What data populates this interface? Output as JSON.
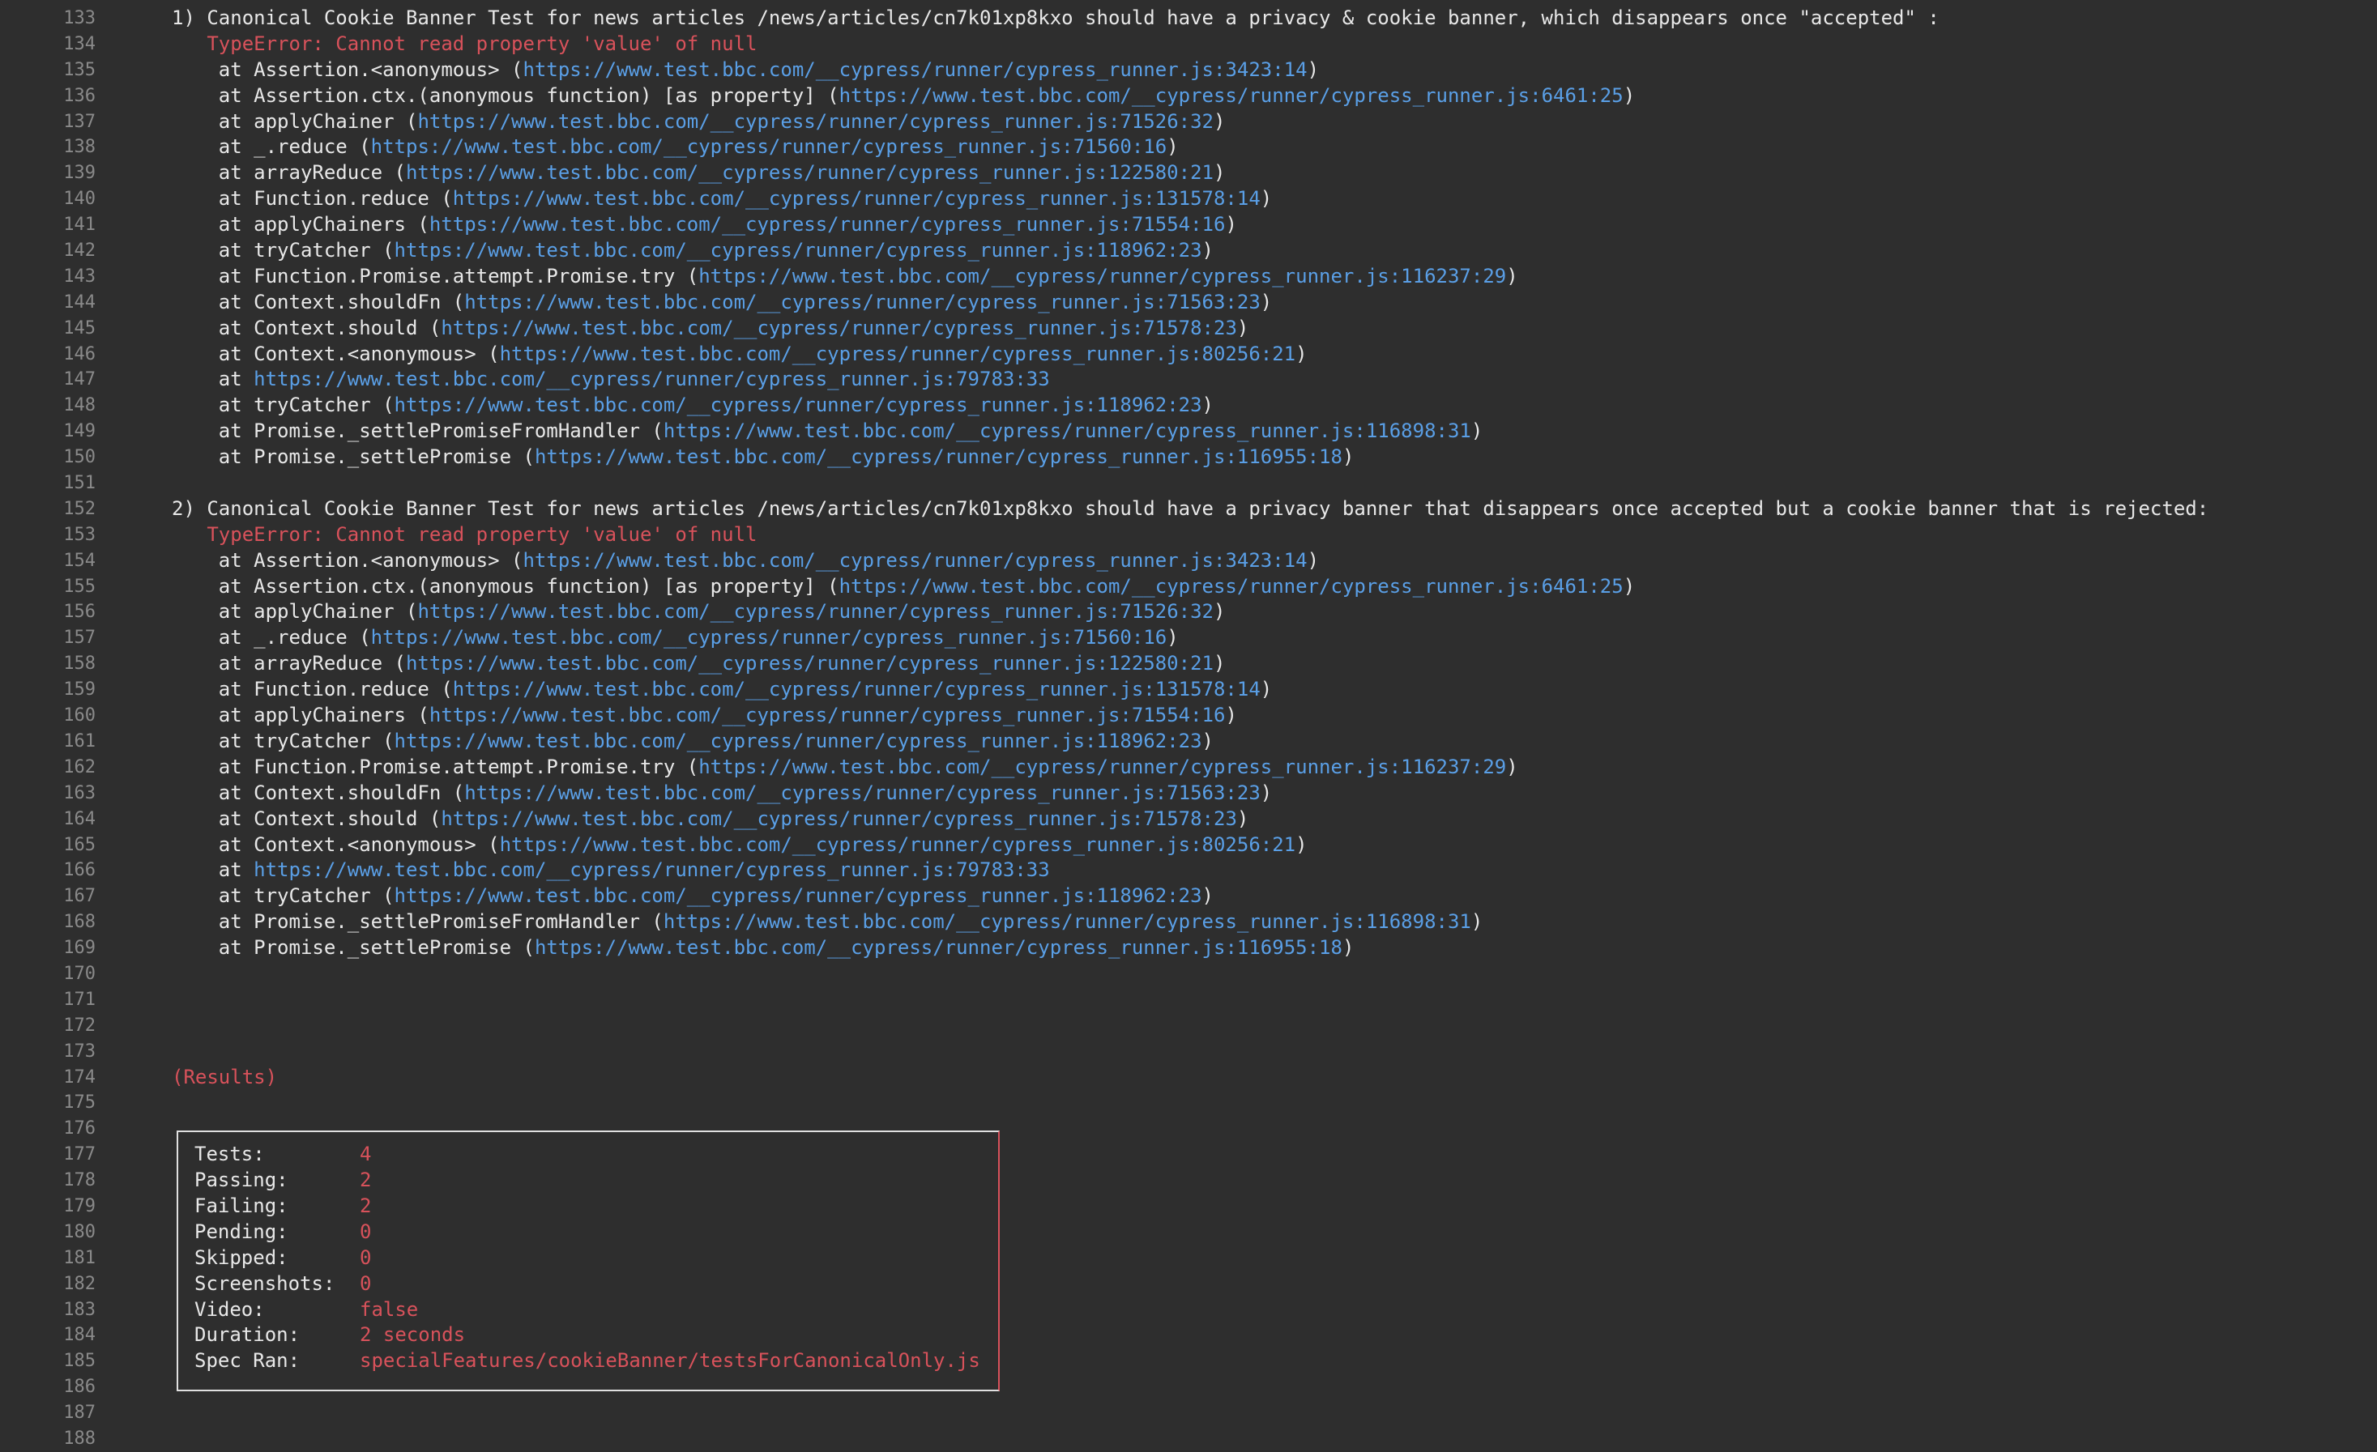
{
  "lines": [
    {
      "n": "133",
      "parts": [
        [
          "plain",
          "1) Canonical Cookie Banner Test for news articles /news/articles/cn7k01xp8kxo should have a privacy & cookie banner, which disappears once \"accepted\" :"
        ]
      ]
    },
    {
      "n": "134",
      "parts": [
        [
          "err",
          "   TypeError: Cannot read property 'value' of null"
        ]
      ]
    },
    {
      "n": "135",
      "parts": [
        [
          "plain",
          "    at Assertion.<anonymous> ("
        ],
        [
          "url",
          "https://www.test.bbc.com/__cypress/runner/cypress_runner.js:3423:14"
        ],
        [
          "plain",
          ")"
        ]
      ]
    },
    {
      "n": "136",
      "parts": [
        [
          "plain",
          "    at Assertion.ctx.(anonymous function) [as property] ("
        ],
        [
          "url",
          "https://www.test.bbc.com/__cypress/runner/cypress_runner.js:6461:25"
        ],
        [
          "plain",
          ")"
        ]
      ]
    },
    {
      "n": "137",
      "parts": [
        [
          "plain",
          "    at applyChainer ("
        ],
        [
          "url",
          "https://www.test.bbc.com/__cypress/runner/cypress_runner.js:71526:32"
        ],
        [
          "plain",
          ")"
        ]
      ]
    },
    {
      "n": "138",
      "parts": [
        [
          "plain",
          "    at _.reduce ("
        ],
        [
          "url",
          "https://www.test.bbc.com/__cypress/runner/cypress_runner.js:71560:16"
        ],
        [
          "plain",
          ")"
        ]
      ]
    },
    {
      "n": "139",
      "parts": [
        [
          "plain",
          "    at arrayReduce ("
        ],
        [
          "url",
          "https://www.test.bbc.com/__cypress/runner/cypress_runner.js:122580:21"
        ],
        [
          "plain",
          ")"
        ]
      ]
    },
    {
      "n": "140",
      "parts": [
        [
          "plain",
          "    at Function.reduce ("
        ],
        [
          "url",
          "https://www.test.bbc.com/__cypress/runner/cypress_runner.js:131578:14"
        ],
        [
          "plain",
          ")"
        ]
      ]
    },
    {
      "n": "141",
      "parts": [
        [
          "plain",
          "    at applyChainers ("
        ],
        [
          "url",
          "https://www.test.bbc.com/__cypress/runner/cypress_runner.js:71554:16"
        ],
        [
          "plain",
          ")"
        ]
      ]
    },
    {
      "n": "142",
      "parts": [
        [
          "plain",
          "    at tryCatcher ("
        ],
        [
          "url",
          "https://www.test.bbc.com/__cypress/runner/cypress_runner.js:118962:23"
        ],
        [
          "plain",
          ")"
        ]
      ]
    },
    {
      "n": "143",
      "parts": [
        [
          "plain",
          "    at Function.Promise.attempt.Promise.try ("
        ],
        [
          "url",
          "https://www.test.bbc.com/__cypress/runner/cypress_runner.js:116237:29"
        ],
        [
          "plain",
          ")"
        ]
      ]
    },
    {
      "n": "144",
      "parts": [
        [
          "plain",
          "    at Context.shouldFn ("
        ],
        [
          "url",
          "https://www.test.bbc.com/__cypress/runner/cypress_runner.js:71563:23"
        ],
        [
          "plain",
          ")"
        ]
      ]
    },
    {
      "n": "145",
      "parts": [
        [
          "plain",
          "    at Context.should ("
        ],
        [
          "url",
          "https://www.test.bbc.com/__cypress/runner/cypress_runner.js:71578:23"
        ],
        [
          "plain",
          ")"
        ]
      ]
    },
    {
      "n": "146",
      "parts": [
        [
          "plain",
          "    at Context.<anonymous> ("
        ],
        [
          "url",
          "https://www.test.bbc.com/__cypress/runner/cypress_runner.js:80256:21"
        ],
        [
          "plain",
          ")"
        ]
      ]
    },
    {
      "n": "147",
      "parts": [
        [
          "plain",
          "    at "
        ],
        [
          "url",
          "https://www.test.bbc.com/__cypress/runner/cypress_runner.js:79783:33"
        ]
      ]
    },
    {
      "n": "148",
      "parts": [
        [
          "plain",
          "    at tryCatcher ("
        ],
        [
          "url",
          "https://www.test.bbc.com/__cypress/runner/cypress_runner.js:118962:23"
        ],
        [
          "plain",
          ")"
        ]
      ]
    },
    {
      "n": "149",
      "parts": [
        [
          "plain",
          "    at Promise._settlePromiseFromHandler ("
        ],
        [
          "url",
          "https://www.test.bbc.com/__cypress/runner/cypress_runner.js:116898:31"
        ],
        [
          "plain",
          ")"
        ]
      ]
    },
    {
      "n": "150",
      "parts": [
        [
          "plain",
          "    at Promise._settlePromise ("
        ],
        [
          "url",
          "https://www.test.bbc.com/__cypress/runner/cypress_runner.js:116955:18"
        ],
        [
          "plain",
          ")"
        ]
      ]
    },
    {
      "n": "151",
      "parts": []
    },
    {
      "n": "152",
      "parts": [
        [
          "plain",
          "2) Canonical Cookie Banner Test for news articles /news/articles/cn7k01xp8kxo should have a privacy banner that disappears once accepted but a cookie banner that is rejected:"
        ]
      ]
    },
    {
      "n": "153",
      "parts": [
        [
          "err",
          "   TypeError: Cannot read property 'value' of null"
        ]
      ]
    },
    {
      "n": "154",
      "parts": [
        [
          "plain",
          "    at Assertion.<anonymous> ("
        ],
        [
          "url",
          "https://www.test.bbc.com/__cypress/runner/cypress_runner.js:3423:14"
        ],
        [
          "plain",
          ")"
        ]
      ]
    },
    {
      "n": "155",
      "parts": [
        [
          "plain",
          "    at Assertion.ctx.(anonymous function) [as property] ("
        ],
        [
          "url",
          "https://www.test.bbc.com/__cypress/runner/cypress_runner.js:6461:25"
        ],
        [
          "plain",
          ")"
        ]
      ]
    },
    {
      "n": "156",
      "parts": [
        [
          "plain",
          "    at applyChainer ("
        ],
        [
          "url",
          "https://www.test.bbc.com/__cypress/runner/cypress_runner.js:71526:32"
        ],
        [
          "plain",
          ")"
        ]
      ]
    },
    {
      "n": "157",
      "parts": [
        [
          "plain",
          "    at _.reduce ("
        ],
        [
          "url",
          "https://www.test.bbc.com/__cypress/runner/cypress_runner.js:71560:16"
        ],
        [
          "plain",
          ")"
        ]
      ]
    },
    {
      "n": "158",
      "parts": [
        [
          "plain",
          "    at arrayReduce ("
        ],
        [
          "url",
          "https://www.test.bbc.com/__cypress/runner/cypress_runner.js:122580:21"
        ],
        [
          "plain",
          ")"
        ]
      ]
    },
    {
      "n": "159",
      "parts": [
        [
          "plain",
          "    at Function.reduce ("
        ],
        [
          "url",
          "https://www.test.bbc.com/__cypress/runner/cypress_runner.js:131578:14"
        ],
        [
          "plain",
          ")"
        ]
      ]
    },
    {
      "n": "160",
      "parts": [
        [
          "plain",
          "    at applyChainers ("
        ],
        [
          "url",
          "https://www.test.bbc.com/__cypress/runner/cypress_runner.js:71554:16"
        ],
        [
          "plain",
          ")"
        ]
      ]
    },
    {
      "n": "161",
      "parts": [
        [
          "plain",
          "    at tryCatcher ("
        ],
        [
          "url",
          "https://www.test.bbc.com/__cypress/runner/cypress_runner.js:118962:23"
        ],
        [
          "plain",
          ")"
        ]
      ]
    },
    {
      "n": "162",
      "parts": [
        [
          "plain",
          "    at Function.Promise.attempt.Promise.try ("
        ],
        [
          "url",
          "https://www.test.bbc.com/__cypress/runner/cypress_runner.js:116237:29"
        ],
        [
          "plain",
          ")"
        ]
      ]
    },
    {
      "n": "163",
      "parts": [
        [
          "plain",
          "    at Context.shouldFn ("
        ],
        [
          "url",
          "https://www.test.bbc.com/__cypress/runner/cypress_runner.js:71563:23"
        ],
        [
          "plain",
          ")"
        ]
      ]
    },
    {
      "n": "164",
      "parts": [
        [
          "plain",
          "    at Context.should ("
        ],
        [
          "url",
          "https://www.test.bbc.com/__cypress/runner/cypress_runner.js:71578:23"
        ],
        [
          "plain",
          ")"
        ]
      ]
    },
    {
      "n": "165",
      "parts": [
        [
          "plain",
          "    at Context.<anonymous> ("
        ],
        [
          "url",
          "https://www.test.bbc.com/__cypress/runner/cypress_runner.js:80256:21"
        ],
        [
          "plain",
          ")"
        ]
      ]
    },
    {
      "n": "166",
      "parts": [
        [
          "plain",
          "    at "
        ],
        [
          "url",
          "https://www.test.bbc.com/__cypress/runner/cypress_runner.js:79783:33"
        ]
      ]
    },
    {
      "n": "167",
      "parts": [
        [
          "plain",
          "    at tryCatcher ("
        ],
        [
          "url",
          "https://www.test.bbc.com/__cypress/runner/cypress_runner.js:118962:23"
        ],
        [
          "plain",
          ")"
        ]
      ]
    },
    {
      "n": "168",
      "parts": [
        [
          "plain",
          "    at Promise._settlePromiseFromHandler ("
        ],
        [
          "url",
          "https://www.test.bbc.com/__cypress/runner/cypress_runner.js:116898:31"
        ],
        [
          "plain",
          ")"
        ]
      ]
    },
    {
      "n": "169",
      "parts": [
        [
          "plain",
          "    at Promise._settlePromise ("
        ],
        [
          "url",
          "https://www.test.bbc.com/__cypress/runner/cypress_runner.js:116955:18"
        ],
        [
          "plain",
          ")"
        ]
      ]
    },
    {
      "n": "170",
      "parts": []
    },
    {
      "n": "171",
      "parts": []
    },
    {
      "n": "172",
      "parts": []
    },
    {
      "n": "173",
      "parts": []
    },
    {
      "n": "174",
      "parts": [
        [
          "err",
          "(Results)"
        ]
      ]
    },
    {
      "n": "175",
      "parts": []
    },
    {
      "n": "176",
      "parts": []
    },
    {
      "n": "177",
      "result": [
        "Tests:",
        "4"
      ]
    },
    {
      "n": "178",
      "result": [
        "Passing:",
        "2"
      ]
    },
    {
      "n": "179",
      "result": [
        "Failing:",
        "2"
      ]
    },
    {
      "n": "180",
      "result": [
        "Pending:",
        "0"
      ]
    },
    {
      "n": "181",
      "result": [
        "Skipped:",
        "0"
      ]
    },
    {
      "n": "182",
      "result": [
        "Screenshots:",
        "0"
      ]
    },
    {
      "n": "183",
      "result": [
        "Video:",
        "false"
      ]
    },
    {
      "n": "184",
      "result": [
        "Duration:",
        "2 seconds"
      ]
    },
    {
      "n": "185",
      "result": [
        "Spec Ran:",
        "specialFeatures/cookieBanner/testsForCanonicalOnly.js"
      ]
    },
    {
      "n": "186",
      "parts": []
    },
    {
      "n": "187",
      "parts": []
    },
    {
      "n": "188",
      "parts": []
    }
  ],
  "colors": {
    "background": "#2e2e2e",
    "text": "#e8e8e8",
    "error": "#d8525b",
    "link": "#5a9fe6",
    "line_number": "#8a8a8a"
  }
}
